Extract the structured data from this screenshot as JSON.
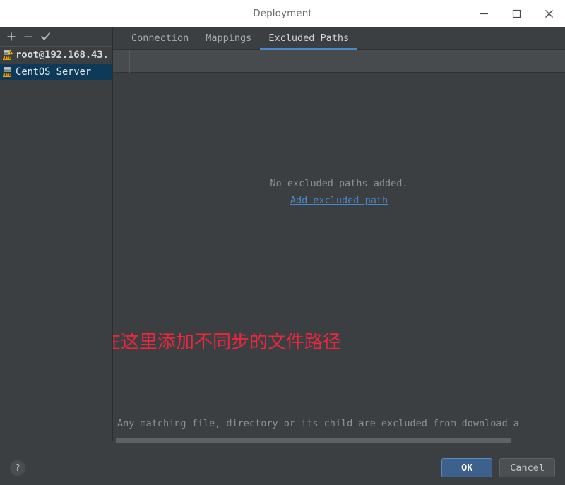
{
  "window": {
    "title": "Deployment",
    "minimize_label": "Minimize",
    "maximize_label": "Maximize",
    "close_label": "Close"
  },
  "sidebar": {
    "toolbar": [
      {
        "name": "add",
        "icon": "plus-icon",
        "label": "+"
      },
      {
        "name": "remove",
        "icon": "minus-icon",
        "label": "−"
      },
      {
        "name": "set-default",
        "icon": "check-icon",
        "label": "✓"
      }
    ],
    "servers": [
      {
        "label": "root@192.168.43.",
        "icon": "sftp-server-warning-icon",
        "selected": false
      },
      {
        "label": "CentOS Server",
        "icon": "sftp-server-icon",
        "selected": true
      }
    ]
  },
  "tabs": [
    {
      "label": "Connection",
      "active": false
    },
    {
      "label": "Mappings",
      "active": false
    },
    {
      "label": "Excluded Paths",
      "active": true
    }
  ],
  "excluded_paths": {
    "empty_message": "No excluded paths added.",
    "add_link": "Add excluded path",
    "hint": "Any matching file, directory or its child are excluded from download a"
  },
  "annotation": {
    "text": "在这里添加不同步的文件路径",
    "color": "#e8283f"
  },
  "footer": {
    "help_label": "?",
    "ok_label": "OK",
    "cancel_label": "Cancel"
  },
  "colors": {
    "accent": "#4a88c7",
    "window_bg": "#3c3f41",
    "selection": "#0d3a58",
    "link": "#4a88c7",
    "primary_button": "#3b618c"
  }
}
